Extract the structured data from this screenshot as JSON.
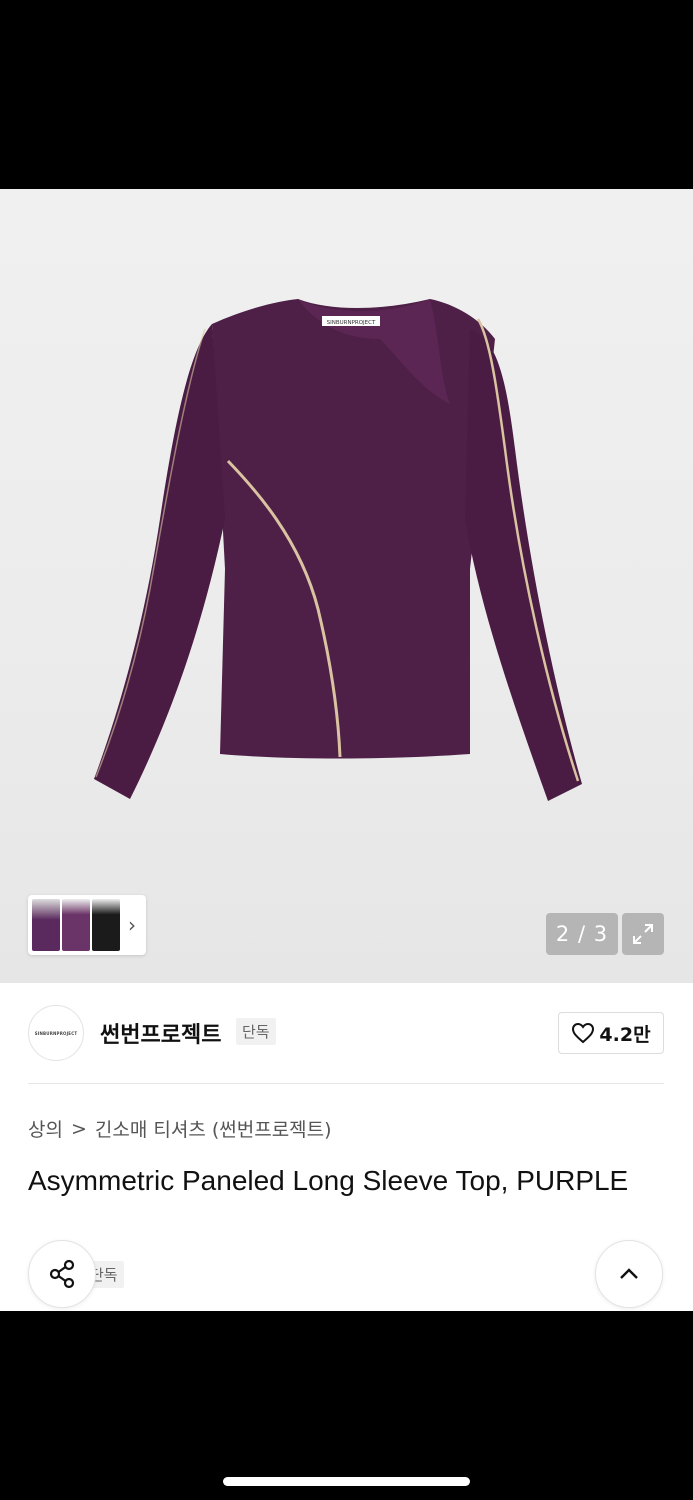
{
  "gallery": {
    "counter": "2 / 3",
    "tag_label": "SINBURNPROJECT",
    "thumb_colors": [
      "#5a2a5e",
      "#6b3468",
      "#1b1b1b"
    ]
  },
  "brand": {
    "logo_text": "SINBURNPROJECT",
    "name": "썬번프로젝트",
    "badge": "단독",
    "likes": "4.2만"
  },
  "breadcrumb": {
    "category": "상의",
    "separator": ">",
    "subcategory": "긴소매 티셔츠 (썬번프로젝트)"
  },
  "product": {
    "title": "Asymmetric Paneled Long Sleeve Top, PURPLE",
    "tag": "단독"
  },
  "colors": {
    "garment": "#4e1f47",
    "piping": "#d9c3a0",
    "page_bg": "#ffffff"
  },
  "icons": [
    "chevron-right-icon",
    "expand-icon",
    "heart-icon",
    "share-icon",
    "chevron-up-icon"
  ]
}
